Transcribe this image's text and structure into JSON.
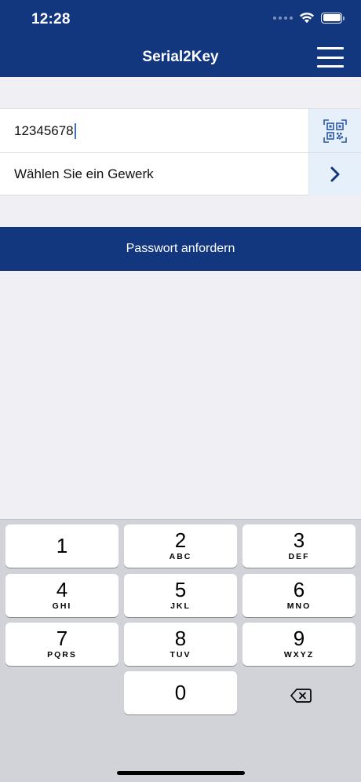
{
  "status_bar": {
    "time": "12:28"
  },
  "header": {
    "title": "Serial2Key",
    "menu_icon": "hamburger-menu-icon"
  },
  "form": {
    "serial_value": "12345678",
    "qr_icon": "qr-code-scan-icon",
    "trade_label": "Wählen Sie ein Gewerk",
    "chevron_icon": "chevron-right-icon"
  },
  "actions": {
    "request_password_label": "Passwort anfordern"
  },
  "colors": {
    "brand": "#12377f",
    "side_button": "#e6f0fa",
    "caret": "#3b6fd8"
  },
  "keyboard": {
    "keys": [
      {
        "digit": "1",
        "letters": ""
      },
      {
        "digit": "2",
        "letters": "ABC"
      },
      {
        "digit": "3",
        "letters": "DEF"
      },
      {
        "digit": "4",
        "letters": "GHI"
      },
      {
        "digit": "5",
        "letters": "JKL"
      },
      {
        "digit": "6",
        "letters": "MNO"
      },
      {
        "digit": "7",
        "letters": "PQRS"
      },
      {
        "digit": "8",
        "letters": "TUV"
      },
      {
        "digit": "9",
        "letters": "WXYZ"
      },
      {
        "digit": "0",
        "letters": ""
      }
    ],
    "delete_icon": "backspace-icon"
  }
}
